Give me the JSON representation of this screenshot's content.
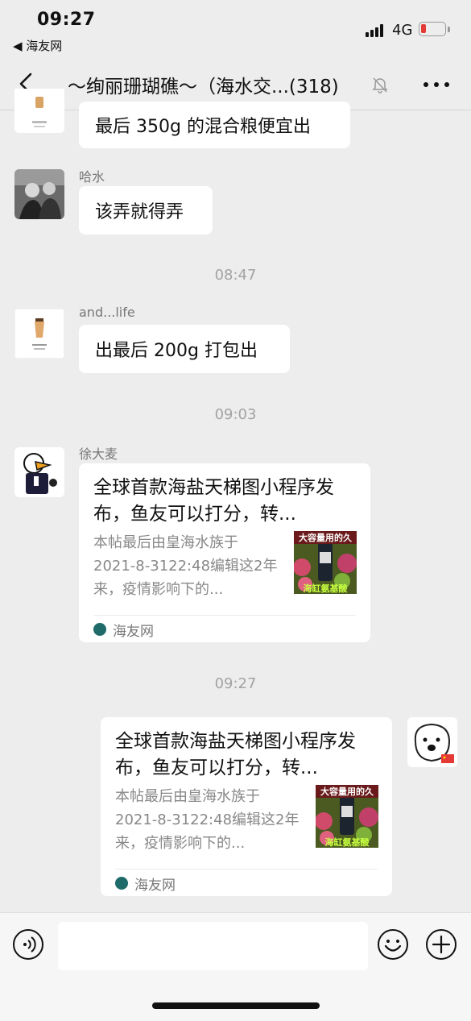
{
  "status_bar": {
    "time": "09:27",
    "back_app": "◀ 海友网",
    "network": "4G"
  },
  "nav": {
    "title": "～绚丽珊瑚礁～（海水交...(318)"
  },
  "messages": [
    {
      "text": "最后 350g 的混合粮便宜出"
    },
    {
      "sender": "哈水",
      "text": "该弄就得弄"
    },
    {
      "sender": "and...life",
      "text": "出最后 200g 打包出"
    },
    {
      "sender": "徐大麦",
      "card": {
        "title": "全球首款海盐天梯图小程序发布，鱼友可以打分，转...",
        "desc": "本帖最后由皇海水族于2021-8-3122:48编辑这2年来，疫情影响下的...",
        "thumb_text": "大容量用的久",
        "thumb_bottom": "海缸氨基酸",
        "source": "海友网"
      }
    },
    {
      "card": {
        "title": "全球首款海盐天梯图小程序发布，鱼友可以打分，转...",
        "desc": "本帖最后由皇海水族于2021-8-3122:48编辑这2年来，疫情影响下的...",
        "thumb_text": "大容量用的久",
        "thumb_bottom": "海缸氨基酸",
        "source": "海友网"
      }
    }
  ],
  "timestamps": [
    "08:47",
    "09:03",
    "09:27"
  ],
  "colors": {
    "background": "#ededed",
    "bubble": "#ffffff",
    "accent_red": "#e53935"
  }
}
